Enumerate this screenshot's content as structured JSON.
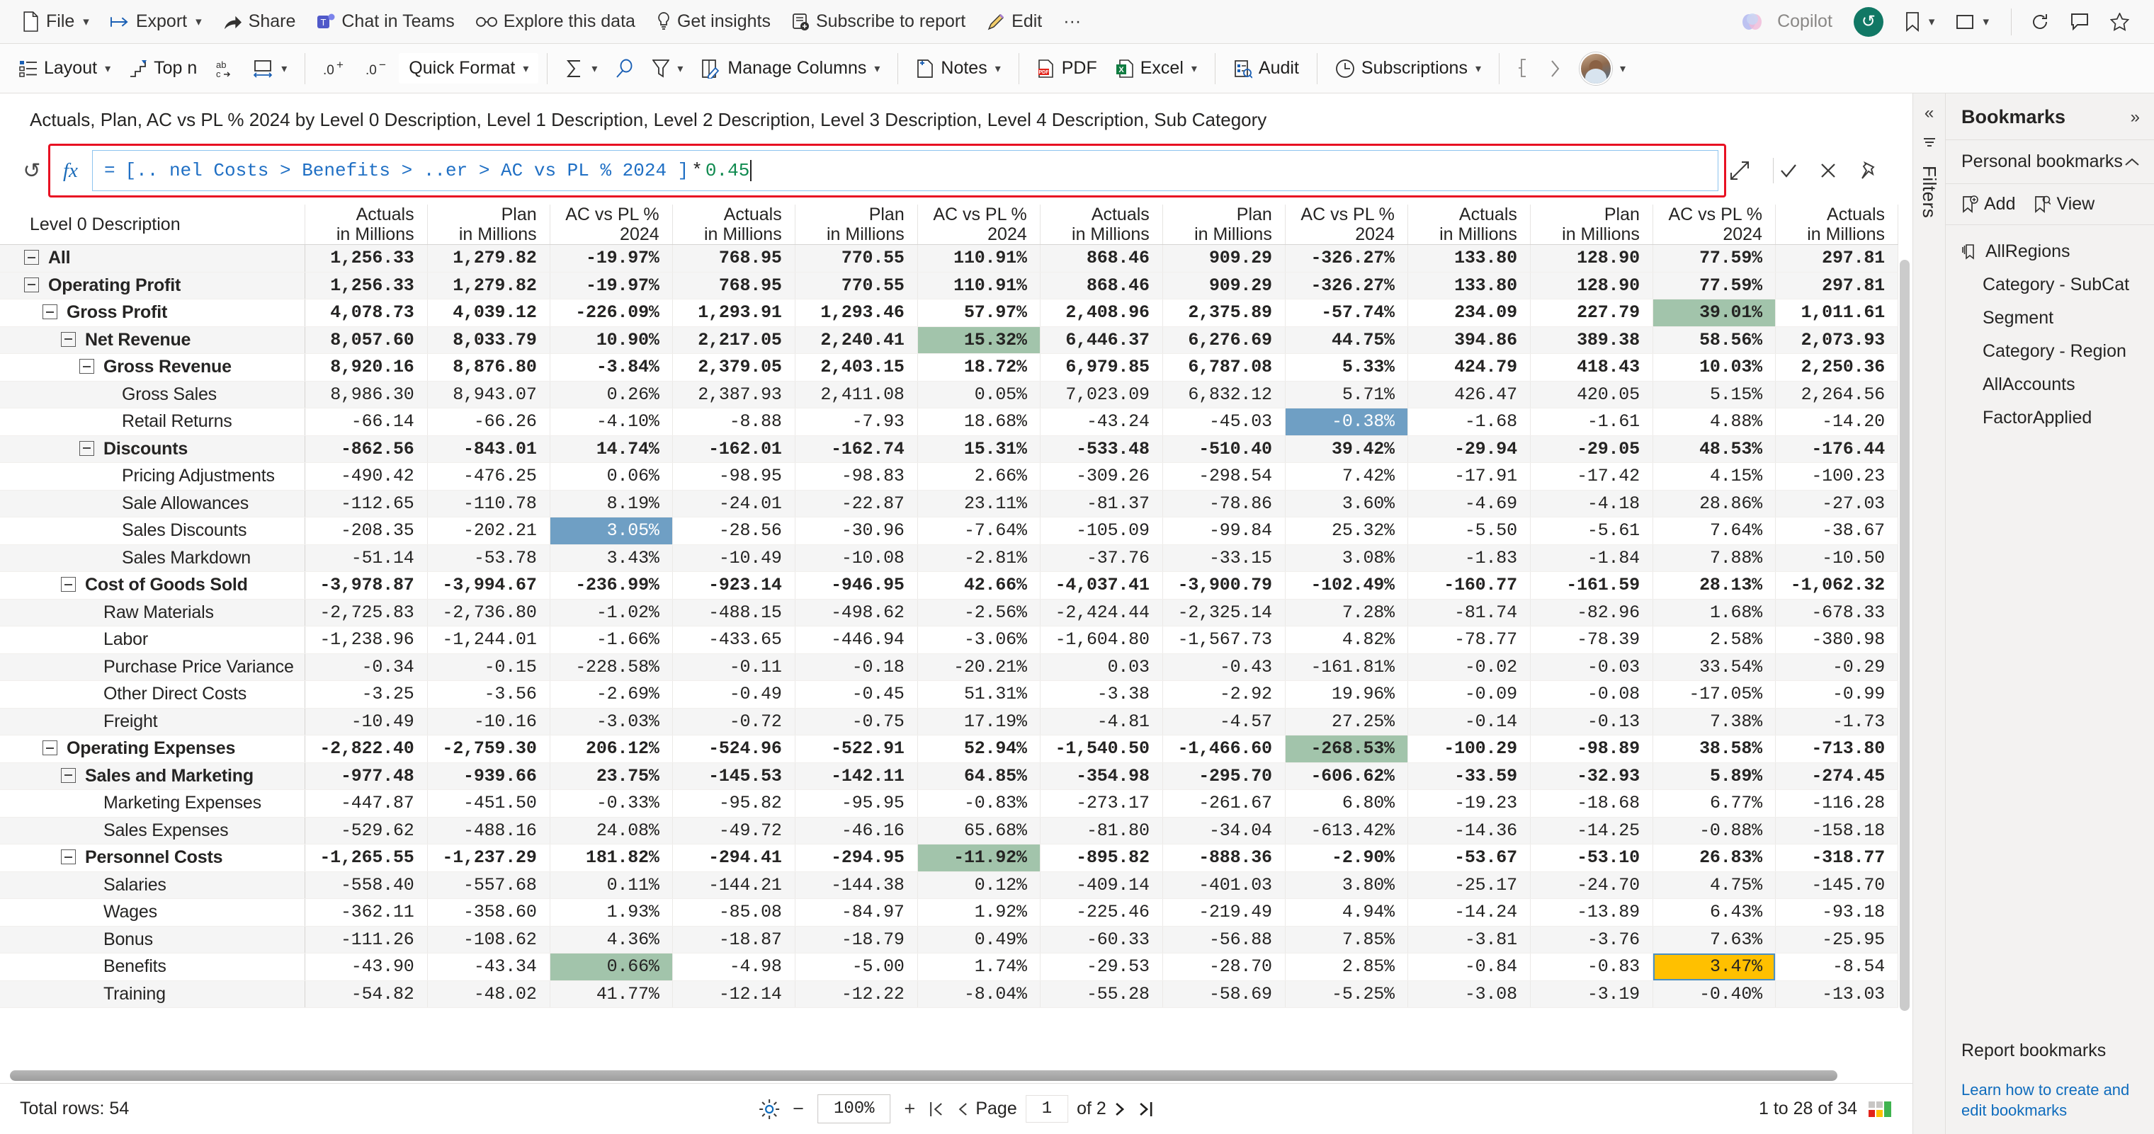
{
  "topbar": {
    "items": [
      {
        "label": "File",
        "icon": "file-icon",
        "caret": true
      },
      {
        "label": "Export",
        "icon": "export-icon",
        "caret": true
      },
      {
        "label": "Share",
        "icon": "share-icon",
        "caret": false
      },
      {
        "label": "Chat in Teams",
        "icon": "teams-icon",
        "caret": false
      },
      {
        "label": "Explore this data",
        "icon": "explore-icon",
        "caret": false
      },
      {
        "label": "Get insights",
        "icon": "lightbulb-icon",
        "caret": false
      },
      {
        "label": "Subscribe to report",
        "icon": "subscribe-icon",
        "caret": false
      },
      {
        "label": "Edit",
        "icon": "pencil-icon",
        "caret": false
      },
      {
        "label": "···",
        "icon": "more-icon",
        "caret": false
      }
    ],
    "copilot_label": "Copilot",
    "right_icons": [
      "refresh-circle-icon",
      "bookmark-icon",
      "view-icon",
      "reset-icon",
      "comment-icon",
      "favorite-icon"
    ]
  },
  "ribbon": {
    "items": [
      {
        "label": "Layout",
        "icon": "layout-icon",
        "caret": true
      },
      {
        "label": "Top n",
        "icon": "topn-icon",
        "caret": false
      },
      {
        "label": "",
        "icon": "wrap-text-icon",
        "caret": false
      },
      {
        "label": "",
        "icon": "column-width-icon",
        "caret": true
      },
      {
        "label": "",
        "icon": "decimal-increase-icon",
        "caret": false
      },
      {
        "label": "",
        "icon": "decimal-decrease-icon",
        "caret": false
      },
      {
        "label": "Quick Format",
        "icon": "",
        "caret": true
      },
      {
        "label": "",
        "icon": "sum-icon",
        "caret": true
      },
      {
        "label": "",
        "icon": "search-icon",
        "caret": false
      },
      {
        "label": "",
        "icon": "filter-icon",
        "caret": true
      },
      {
        "label": "Manage Columns",
        "icon": "manage-columns-icon",
        "caret": true
      },
      {
        "label": "Notes",
        "icon": "add-note-icon",
        "caret": true
      },
      {
        "label": "PDF",
        "icon": "pdf-icon",
        "caret": false
      },
      {
        "label": "Excel",
        "icon": "excel-icon",
        "caret": true
      },
      {
        "label": "Audit",
        "icon": "audit-icon",
        "caret": false
      },
      {
        "label": "Subscriptions",
        "icon": "subscriptions-icon",
        "caret": true
      }
    ]
  },
  "visual": {
    "title": "Actuals, Plan, AC vs PL % 2024 by Level 0 Description, Level 1 Description, Level 2 Description, Level 3 Description, Level 4 Description, Sub Category"
  },
  "formula": {
    "fx_label": "fx",
    "equals": "=",
    "reference": "[.. nel Costs > Benefits > ..er > AC vs PL % 2024 ]",
    "operator": "*",
    "number": "0.45",
    "reset_icon": "reset-icon",
    "expand_icon": "expand-icon",
    "accept_icon": "check-icon",
    "cancel_icon": "close-icon",
    "pin_icon": "pin-icon"
  },
  "table": {
    "row_header": "Level 0 Description",
    "columns": [
      {
        "l1": "Actuals",
        "l2": "in Millions"
      },
      {
        "l1": "Plan",
        "l2": "in Millions"
      },
      {
        "l1": "AC vs PL %",
        "l2": "2024"
      },
      {
        "l1": "Actuals",
        "l2": "in Millions"
      },
      {
        "l1": "Plan",
        "l2": "in Millions"
      },
      {
        "l1": "AC vs PL %",
        "l2": "2024"
      },
      {
        "l1": "Actuals",
        "l2": "in Millions"
      },
      {
        "l1": "Plan",
        "l2": "in Millions"
      },
      {
        "l1": "AC vs PL %",
        "l2": "2024"
      },
      {
        "l1": "Actuals",
        "l2": "in Millions"
      },
      {
        "l1": "Plan",
        "l2": "in Millions"
      },
      {
        "l1": "AC vs PL %",
        "l2": "2024"
      },
      {
        "l1": "Actuals",
        "l2": "in Millions"
      }
    ],
    "rows": [
      {
        "label": "All",
        "indent": 0,
        "expandable": true,
        "bold": true,
        "total": true,
        "values": [
          "1,256.33",
          "1,279.82",
          "-19.97%",
          "768.95",
          "770.55",
          "110.91%",
          "868.46",
          "909.29",
          "-326.27%",
          "133.80",
          "128.90",
          "77.59%",
          "297.81"
        ]
      },
      {
        "label": "Operating Profit",
        "indent": 0,
        "expandable": true,
        "bold": true,
        "values": [
          "1,256.33",
          "1,279.82",
          "-19.97%",
          "768.95",
          "770.55",
          "110.91%",
          "868.46",
          "909.29",
          "-326.27%",
          "133.80",
          "128.90",
          "77.59%",
          "297.81"
        ]
      },
      {
        "label": "Gross Profit",
        "indent": 1,
        "expandable": true,
        "bold": true,
        "values": [
          "4,078.73",
          "4,039.12",
          "-226.09%",
          "1,293.91",
          "1,293.46",
          "57.97%",
          "2,408.96",
          "2,375.89",
          "-57.74%",
          "234.09",
          "227.79",
          "39.01%",
          "1,011.61"
        ],
        "highlights": {
          "11": "green"
        }
      },
      {
        "label": "Net Revenue",
        "indent": 2,
        "expandable": true,
        "bold": true,
        "values": [
          "8,057.60",
          "8,033.79",
          "10.90%",
          "2,217.05",
          "2,240.41",
          "15.32%",
          "6,446.37",
          "6,276.69",
          "44.75%",
          "394.86",
          "389.38",
          "58.56%",
          "2,073.93"
        ],
        "highlights": {
          "5": "green"
        }
      },
      {
        "label": "Gross Revenue",
        "indent": 3,
        "expandable": true,
        "bold": true,
        "values": [
          "8,920.16",
          "8,876.80",
          "-3.84%",
          "2,379.05",
          "2,403.15",
          "18.72%",
          "6,979.85",
          "6,787.08",
          "5.33%",
          "424.79",
          "418.43",
          "10.03%",
          "2,250.36"
        ]
      },
      {
        "label": "Gross Sales",
        "indent": 4,
        "expandable": false,
        "bold": false,
        "values": [
          "8,986.30",
          "8,943.07",
          "0.26%",
          "2,387.93",
          "2,411.08",
          "0.05%",
          "7,023.09",
          "6,832.12",
          "5.71%",
          "426.47",
          "420.05",
          "5.15%",
          "2,264.56"
        ]
      },
      {
        "label": "Retail Returns",
        "indent": 4,
        "expandable": false,
        "bold": false,
        "values": [
          "-66.14",
          "-66.26",
          "-4.10%",
          "-8.88",
          "-7.93",
          "18.68%",
          "-43.24",
          "-45.03",
          "-0.38%",
          "-1.68",
          "-1.61",
          "4.88%",
          "-14.20"
        ],
        "highlights": {
          "8": "blue"
        }
      },
      {
        "label": "Discounts",
        "indent": 3,
        "expandable": true,
        "bold": true,
        "values": [
          "-862.56",
          "-843.01",
          "14.74%",
          "-162.01",
          "-162.74",
          "15.31%",
          "-533.48",
          "-510.40",
          "39.42%",
          "-29.94",
          "-29.05",
          "48.53%",
          "-176.44"
        ]
      },
      {
        "label": "Pricing Adjustments",
        "indent": 4,
        "expandable": false,
        "bold": false,
        "values": [
          "-490.42",
          "-476.25",
          "0.06%",
          "-98.95",
          "-98.83",
          "2.66%",
          "-309.26",
          "-298.54",
          "7.42%",
          "-17.91",
          "-17.42",
          "4.15%",
          "-100.23"
        ]
      },
      {
        "label": "Sale Allowances",
        "indent": 4,
        "expandable": false,
        "bold": false,
        "values": [
          "-112.65",
          "-110.78",
          "8.19%",
          "-24.01",
          "-22.87",
          "23.11%",
          "-81.37",
          "-78.86",
          "3.60%",
          "-4.69",
          "-4.18",
          "28.86%",
          "-27.03"
        ]
      },
      {
        "label": "Sales Discounts",
        "indent": 4,
        "expandable": false,
        "bold": false,
        "values": [
          "-208.35",
          "-202.21",
          "3.05%",
          "-28.56",
          "-30.96",
          "-7.64%",
          "-105.09",
          "-99.84",
          "25.32%",
          "-5.50",
          "-5.61",
          "7.64%",
          "-38.67"
        ],
        "highlights": {
          "2": "blue"
        }
      },
      {
        "label": "Sales Markdown",
        "indent": 4,
        "expandable": false,
        "bold": false,
        "values": [
          "-51.14",
          "-53.78",
          "3.43%",
          "-10.49",
          "-10.08",
          "-2.81%",
          "-37.76",
          "-33.15",
          "3.08%",
          "-1.83",
          "-1.84",
          "7.88%",
          "-10.50"
        ]
      },
      {
        "label": "Cost of Goods Sold",
        "indent": 2,
        "expandable": true,
        "bold": true,
        "values": [
          "-3,978.87",
          "-3,994.67",
          "-236.99%",
          "-923.14",
          "-946.95",
          "42.66%",
          "-4,037.41",
          "-3,900.79",
          "-102.49%",
          "-160.77",
          "-161.59",
          "28.13%",
          "-1,062.32"
        ]
      },
      {
        "label": "Raw Materials",
        "indent": 3,
        "expandable": false,
        "bold": false,
        "values": [
          "-2,725.83",
          "-2,736.80",
          "-1.02%",
          "-488.15",
          "-498.62",
          "-2.56%",
          "-2,424.44",
          "-2,325.14",
          "7.28%",
          "-81.74",
          "-82.96",
          "1.68%",
          "-678.33"
        ]
      },
      {
        "label": "Labor",
        "indent": 3,
        "expandable": false,
        "bold": false,
        "values": [
          "-1,238.96",
          "-1,244.01",
          "-1.66%",
          "-433.65",
          "-446.94",
          "-3.06%",
          "-1,604.80",
          "-1,567.73",
          "4.82%",
          "-78.77",
          "-78.39",
          "2.58%",
          "-380.98"
        ]
      },
      {
        "label": "Purchase Price Variance",
        "indent": 3,
        "expandable": false,
        "bold": false,
        "values": [
          "-0.34",
          "-0.15",
          "-228.58%",
          "-0.11",
          "-0.18",
          "-20.21%",
          "0.03",
          "-0.43",
          "-161.81%",
          "-0.02",
          "-0.03",
          "33.54%",
          "-0.29"
        ]
      },
      {
        "label": "Other Direct Costs",
        "indent": 3,
        "expandable": false,
        "bold": false,
        "values": [
          "-3.25",
          "-3.56",
          "-2.69%",
          "-0.49",
          "-0.45",
          "51.31%",
          "-3.38",
          "-2.92",
          "19.96%",
          "-0.09",
          "-0.08",
          "-17.05%",
          "-0.99"
        ]
      },
      {
        "label": "Freight",
        "indent": 3,
        "expandable": false,
        "bold": false,
        "values": [
          "-10.49",
          "-10.16",
          "-3.03%",
          "-0.72",
          "-0.75",
          "17.19%",
          "-4.81",
          "-4.57",
          "27.25%",
          "-0.14",
          "-0.13",
          "7.38%",
          "-1.73"
        ]
      },
      {
        "label": "Operating Expenses",
        "indent": 1,
        "expandable": true,
        "bold": true,
        "values": [
          "-2,822.40",
          "-2,759.30",
          "206.12%",
          "-524.96",
          "-522.91",
          "52.94%",
          "-1,540.50",
          "-1,466.60",
          "-268.53%",
          "-100.29",
          "-98.89",
          "38.58%",
          "-713.80"
        ],
        "highlights": {
          "8": "green"
        }
      },
      {
        "label": "Sales and Marketing",
        "indent": 2,
        "expandable": true,
        "bold": true,
        "values": [
          "-977.48",
          "-939.66",
          "23.75%",
          "-145.53",
          "-142.11",
          "64.85%",
          "-354.98",
          "-295.70",
          "-606.62%",
          "-33.59",
          "-32.93",
          "5.89%",
          "-274.45"
        ]
      },
      {
        "label": "Marketing Expenses",
        "indent": 3,
        "expandable": false,
        "bold": false,
        "values": [
          "-447.87",
          "-451.50",
          "-0.33%",
          "-95.82",
          "-95.95",
          "-0.83%",
          "-273.17",
          "-261.67",
          "6.80%",
          "-19.23",
          "-18.68",
          "6.77%",
          "-116.28"
        ]
      },
      {
        "label": "Sales Expenses",
        "indent": 3,
        "expandable": false,
        "bold": false,
        "values": [
          "-529.62",
          "-488.16",
          "24.08%",
          "-49.72",
          "-46.16",
          "65.68%",
          "-81.80",
          "-34.04",
          "-613.42%",
          "-14.36",
          "-14.25",
          "-0.88%",
          "-158.18"
        ]
      },
      {
        "label": "Personnel Costs",
        "indent": 2,
        "expandable": true,
        "bold": true,
        "values": [
          "-1,265.55",
          "-1,237.29",
          "181.82%",
          "-294.41",
          "-294.95",
          "-11.92%",
          "-895.82",
          "-888.36",
          "-2.90%",
          "-53.67",
          "-53.10",
          "26.83%",
          "-318.77"
        ],
        "highlights": {
          "5": "green"
        }
      },
      {
        "label": "Salaries",
        "indent": 3,
        "expandable": false,
        "bold": false,
        "values": [
          "-558.40",
          "-557.68",
          "0.11%",
          "-144.21",
          "-144.38",
          "0.12%",
          "-409.14",
          "-401.03",
          "3.80%",
          "-25.17",
          "-24.70",
          "4.75%",
          "-145.70"
        ]
      },
      {
        "label": "Wages",
        "indent": 3,
        "expandable": false,
        "bold": false,
        "values": [
          "-362.11",
          "-358.60",
          "1.93%",
          "-85.08",
          "-84.97",
          "1.92%",
          "-225.46",
          "-219.49",
          "4.94%",
          "-14.24",
          "-13.89",
          "6.43%",
          "-93.18"
        ]
      },
      {
        "label": "Bonus",
        "indent": 3,
        "expandable": false,
        "bold": false,
        "values": [
          "-111.26",
          "-108.62",
          "4.36%",
          "-18.87",
          "-18.79",
          "0.49%",
          "-60.33",
          "-56.88",
          "7.85%",
          "-3.81",
          "-3.76",
          "7.63%",
          "-25.95"
        ]
      },
      {
        "label": "Benefits",
        "indent": 3,
        "expandable": false,
        "bold": false,
        "values": [
          "-43.90",
          "-43.34",
          "0.66%",
          "-4.98",
          "-5.00",
          "1.74%",
          "-29.53",
          "-28.70",
          "2.85%",
          "-0.84",
          "-0.83",
          "3.47%",
          "-8.54"
        ],
        "highlights": {
          "2": "green",
          "11": "orange"
        }
      },
      {
        "label": "Training",
        "indent": 3,
        "expandable": false,
        "bold": false,
        "values": [
          "-54.82",
          "-48.02",
          "41.77%",
          "-12.14",
          "-12.22",
          "-8.04%",
          "-55.28",
          "-58.69",
          "-5.25%",
          "-3.08",
          "-3.19",
          "-0.40%",
          "-13.03"
        ]
      }
    ]
  },
  "statusbar": {
    "total_rows": "Total rows: 54",
    "settings_icon": "gear-icon",
    "zoom_minus": "−",
    "zoom_value": "100%",
    "zoom_plus": "+",
    "first_page_icon": "first-page-icon",
    "prev_page_icon": "prev-page-icon",
    "page_label": "Page",
    "page_value": "1",
    "page_of": "of 2",
    "next_page_icon": "next-page-icon",
    "last_page_icon": "last-page-icon",
    "record_range": "1 to 28 of 34"
  },
  "filters": {
    "collapse_icon": "collapse-left-icon",
    "filter_icon": "filter-panel-icon",
    "label": "Filters"
  },
  "bookmarks": {
    "title": "Bookmarks",
    "expand_icon": "expand-right-icon",
    "section_title": "Personal bookmarks",
    "section_chevron": "chevron-up-icon",
    "add_label": "Add",
    "view_label": "View",
    "items": [
      {
        "label": "AllRegions",
        "child": false,
        "icon": "bookmark-applied-icon"
      },
      {
        "label": "Category - SubCat",
        "child": true,
        "icon": ""
      },
      {
        "label": "Segment",
        "child": true,
        "icon": ""
      },
      {
        "label": "Category - Region",
        "child": true,
        "icon": ""
      },
      {
        "label": "AllAccounts",
        "child": true,
        "icon": ""
      },
      {
        "label": "FactorApplied",
        "child": true,
        "icon": ""
      }
    ],
    "report_title": "Report bookmarks",
    "help_link": "Learn how to create and edit bookmarks"
  },
  "colors": {
    "green": "#a2c4ab",
    "blue": "#6f9fc4",
    "orange": "#ffc000",
    "red_outline": "#e81123",
    "link": "#0f6cbd",
    "teal": "#117865"
  }
}
